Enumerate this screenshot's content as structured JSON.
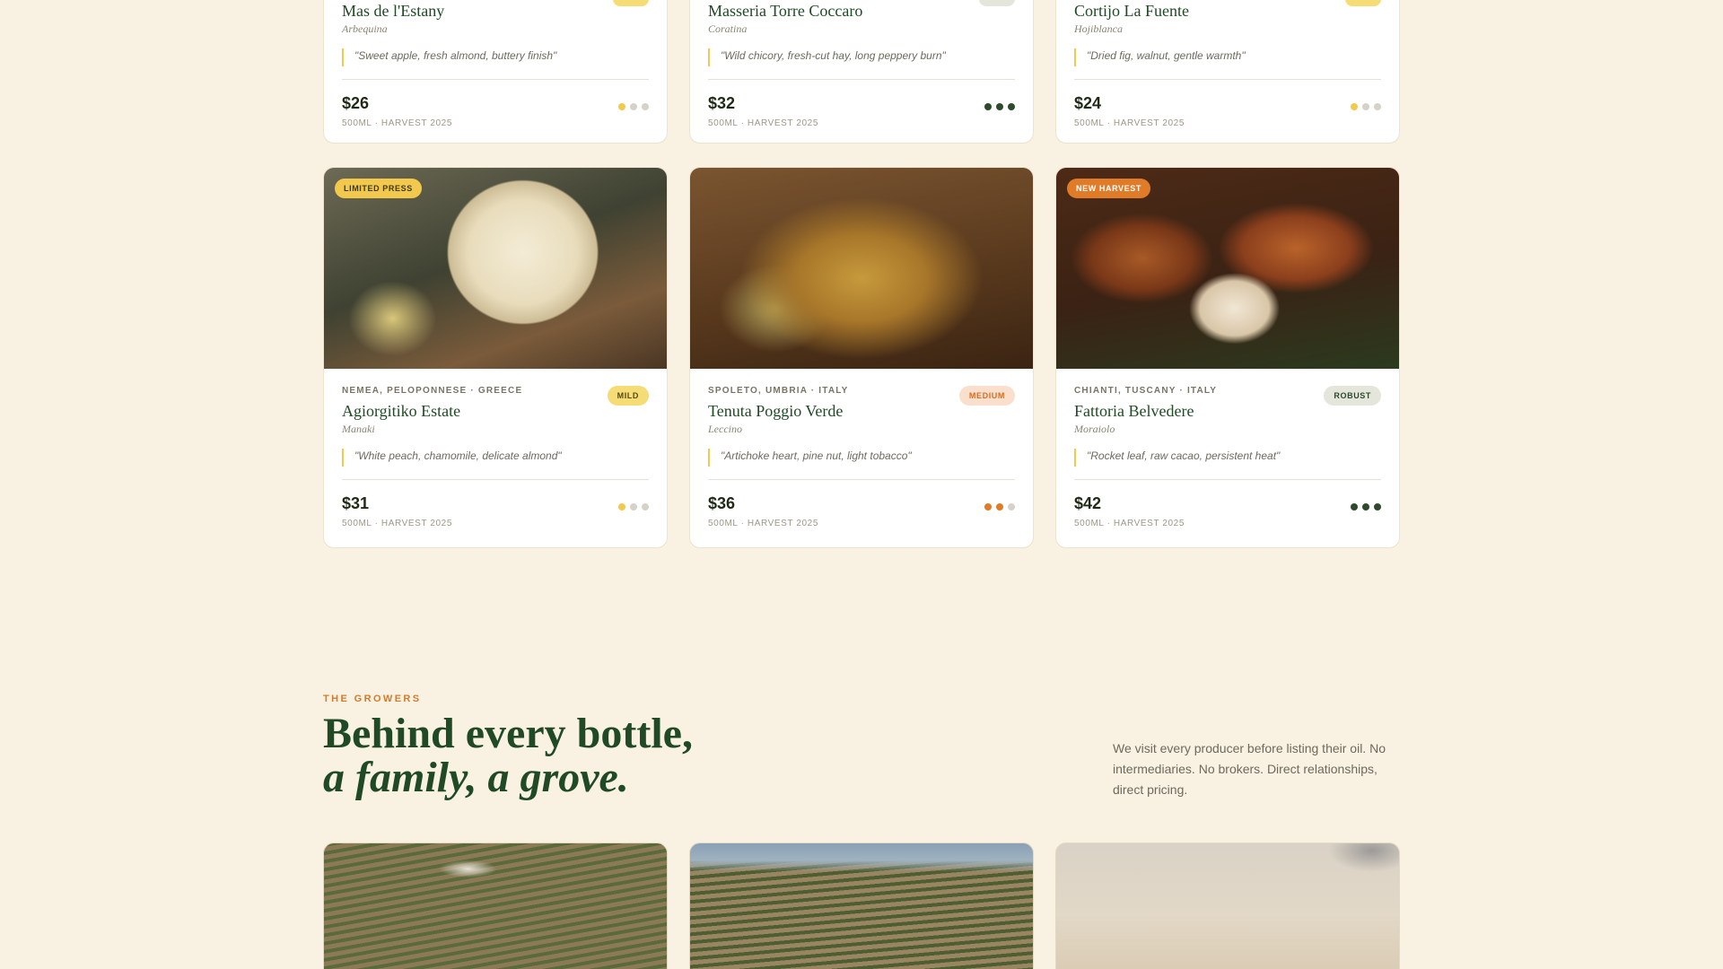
{
  "top_cards": [
    {
      "name": "Mas de l'Estany",
      "cultivar": "Arbequina",
      "notes": "\"Sweet apple, fresh almond, buttery finish\"",
      "price": "$26",
      "meta": "500ML · HARVEST 2025",
      "intensity": 1,
      "dot_color": "#f2c94c",
      "badge_color": "#f6dc74"
    },
    {
      "name": "Masseria Torre Coccaro",
      "cultivar": "Coratina",
      "notes": "\"Wild chicory, fresh-cut hay, long peppery burn\"",
      "price": "$32",
      "meta": "500ML · HARVEST 2025",
      "intensity": 3,
      "dot_color": "#2d4a2a",
      "badge_color": "#e4e6dc"
    },
    {
      "name": "Cortijo La Fuente",
      "cultivar": "Hojiblanca",
      "notes": "\"Dried fig, walnut, gentle warmth\"",
      "price": "$24",
      "meta": "500ML · HARVEST 2025",
      "intensity": 1,
      "dot_color": "#f2c94c",
      "badge_color": "#f6dc74"
    }
  ],
  "cards": [
    {
      "flag": "LIMITED PRESS",
      "region": "NEMEA, PELOPONNESE · GREECE",
      "badge": "MILD",
      "name": "Agiorgitiko Estate",
      "cultivar": "Manaki",
      "notes": "\"White peach, chamomile, delicate almond\"",
      "price": "$31",
      "meta": "500ML · HARVEST 2025",
      "intensity": 1,
      "dot_color": "#f2c94c"
    },
    {
      "flag": "",
      "region": "SPOLETO, UMBRIA · ITALY",
      "badge": "MEDIUM",
      "name": "Tenuta Poggio Verde",
      "cultivar": "Leccino",
      "notes": "\"Artichoke heart, pine nut, light tobacco\"",
      "price": "$36",
      "meta": "500ML · HARVEST 2025",
      "intensity": 2,
      "dot_color": "#e07b28"
    },
    {
      "flag": "NEW HARVEST",
      "region": "CHIANTI, TUSCANY · ITALY",
      "badge": "ROBUST",
      "name": "Fattoria Belvedere",
      "cultivar": "Moraiolo",
      "notes": "\"Rocket leaf, raw cacao, persistent heat\"",
      "price": "$42",
      "meta": "500ML · HARVEST 2025",
      "intensity": 3,
      "dot_color": "#2d4a2a"
    }
  ],
  "growers": {
    "eyebrow": "THE GROWERS",
    "headline_line1": "Behind every bottle,",
    "headline_line2": "a family, a grove.",
    "intro": "We visit every producer before listing their oil. No intermediaries. No brokers. Direct relationships, direct pricing."
  },
  "colors": {
    "background": "#f9f1e1",
    "brand_green": "#1f4a25",
    "accent_orange": "#d47b2a",
    "accent_yellow": "#f2c94c"
  }
}
